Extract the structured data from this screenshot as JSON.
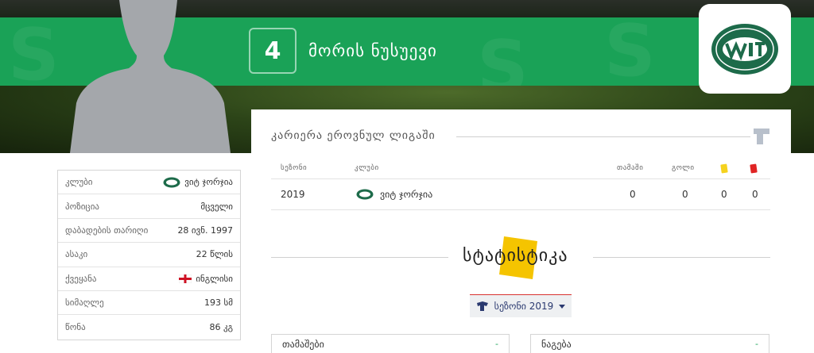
{
  "hero": {
    "number": "4",
    "player_name": "მორის ნუსუევი"
  },
  "info": [
    {
      "label": "კლუბი",
      "value": "ვიტ ჯორჯია"
    },
    {
      "label": "პოზიცია",
      "value": "მცველი"
    },
    {
      "label": "დაბადების თარიღი",
      "value": "28 ივნ. 1997"
    },
    {
      "label": "ასაკი",
      "value": "22 წლის"
    },
    {
      "label": "ქვეყანა",
      "value": "ინგლისი"
    },
    {
      "label": "სიმაღლე",
      "value": "193 სმ"
    },
    {
      "label": "წონა",
      "value": "86 კგ"
    }
  ],
  "career": {
    "title": "კარიერა ეროვნულ ლიგაში",
    "headers": {
      "season": "სეზონი",
      "club": "კლუბი",
      "games": "თამაში",
      "goals": "გოლი"
    },
    "row": {
      "season": "2019",
      "club": "ვიტ ჯორჯია",
      "games": "0",
      "goals": "0",
      "yellow": "0",
      "red": "0"
    }
  },
  "stats": {
    "title": "სტატისტიკა",
    "season_select": "სეზონი 2019",
    "boxes": [
      {
        "label": "თამაშები",
        "value": "-"
      },
      {
        "label": "ნაგება",
        "value": "-"
      }
    ]
  },
  "colors": {
    "brand_green": "#1aa257",
    "accent_yellow": "#f5c400",
    "card_yellow": "#f5d21e",
    "card_red": "#e02424",
    "logo_green": "#1d6b4a"
  },
  "icons": {
    "country_flag": "england-flag-icon",
    "club_badge": "wit-georgia-badge-icon",
    "season_icon": "season-icon",
    "career_icon": "career-icon"
  }
}
